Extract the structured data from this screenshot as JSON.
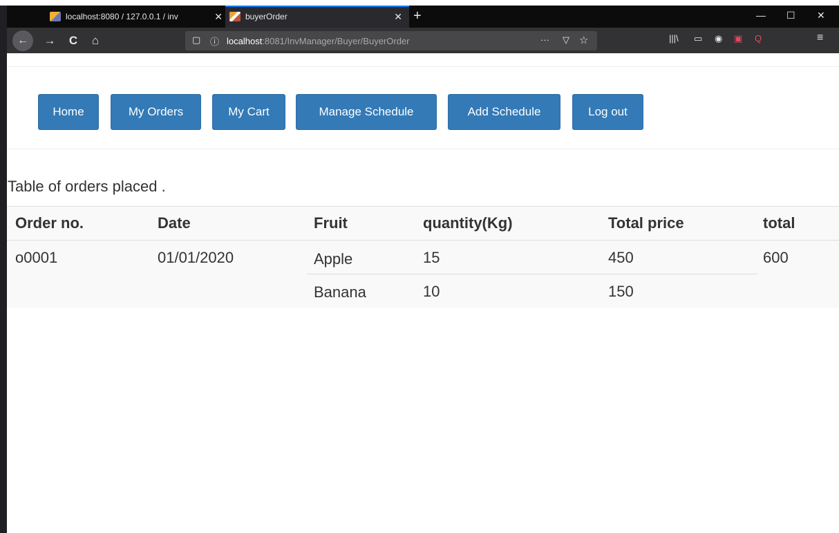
{
  "browser": {
    "tabs": [
      {
        "title": "localhost:8080 / 127.0.0.1 / inv"
      },
      {
        "title": "buyerOrder"
      }
    ],
    "url": {
      "host": "localhost",
      "rest": ":8081/InvManager/Buyer/BuyerOrder"
    },
    "icons": {
      "back": "←",
      "forward": "→",
      "reload": "C",
      "home": "⌂",
      "shield": "▢",
      "info": "ⓘ",
      "more": "···",
      "pocket": "▽",
      "star": "☆",
      "library": "|||\\",
      "sidebar": "▭",
      "account": "◉",
      "extension": "▣",
      "search": "Q",
      "menu": "≡",
      "minimize": "—",
      "maximize": "☐",
      "close": "✕",
      "newtab": "+",
      "tabclose": "✕"
    },
    "colors": {
      "tabstrip": "#0c0c0d",
      "navbar": "#323234",
      "accent": "#0a84ff"
    }
  },
  "nav": {
    "buttons": [
      {
        "label": "Home"
      },
      {
        "label": "My Orders"
      },
      {
        "label": "My Cart"
      },
      {
        "label": "Manage Schedule"
      },
      {
        "label": "Add Schedule"
      },
      {
        "label": "Log out"
      }
    ],
    "color": "#337ab7"
  },
  "caption": "Table of orders placed .",
  "table": {
    "headers": [
      "Order no.",
      "Date",
      "Fruit",
      "quantity(Kg)",
      "Total price",
      "total"
    ],
    "order": {
      "order_no": "o0001",
      "date": "01/01/2020",
      "items": [
        {
          "fruit": "Apple",
          "quantity": "15",
          "price": "450"
        },
        {
          "fruit": "Banana",
          "quantity": "10",
          "price": "150"
        }
      ],
      "total": "600"
    }
  }
}
